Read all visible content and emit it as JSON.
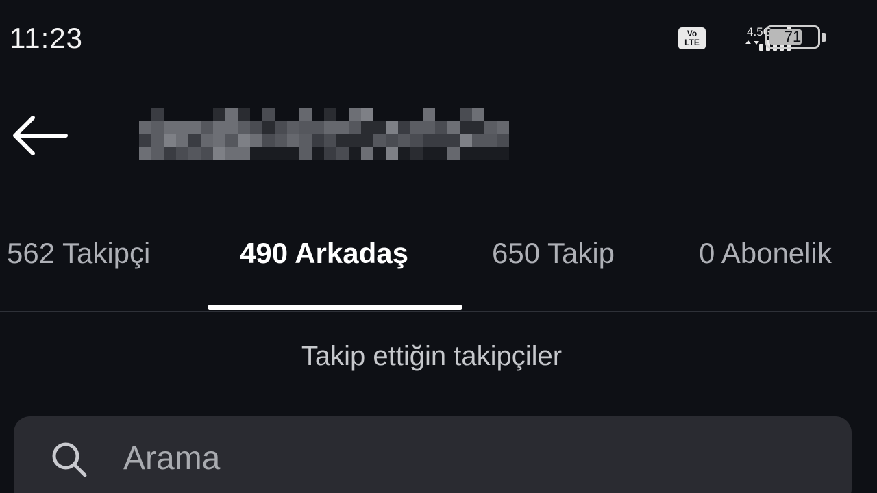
{
  "status_bar": {
    "time": "11:23",
    "volte_label": "Vo\nLTE",
    "network": "4.5G",
    "battery_level": 71,
    "battery_text": "71"
  },
  "header": {
    "back_icon": "arrow-left-icon",
    "username_blurred": true
  },
  "tabs": [
    {
      "label": "562 Takipçi",
      "active": false
    },
    {
      "label": "490 Arkadaş",
      "active": true
    },
    {
      "label": "650 Takip",
      "active": false
    },
    {
      "label": "0 Abonelik",
      "active": false
    }
  ],
  "section": {
    "title": "Takip ettiğin takipçiler"
  },
  "search": {
    "icon": "search-icon",
    "placeholder": "Arama",
    "value": ""
  },
  "colors": {
    "background": "#0e1015",
    "active_tab": "#ffffff",
    "inactive_tab": "#aeb0b6",
    "search_bg": "#2a2b31"
  }
}
